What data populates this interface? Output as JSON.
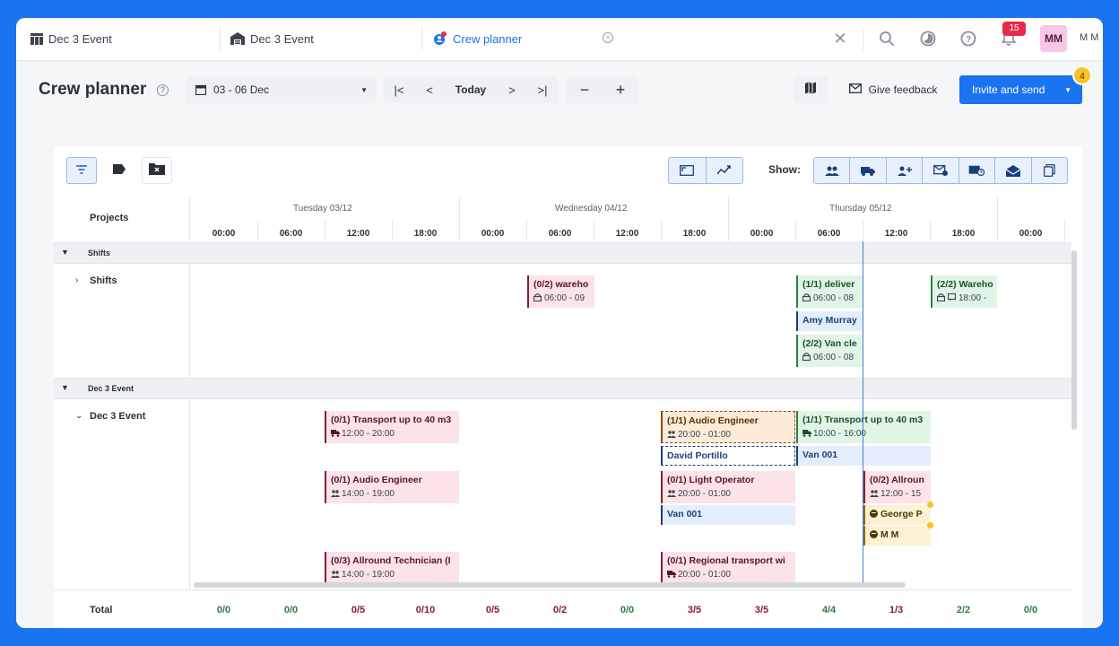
{
  "tabs": [
    {
      "label": "Dec 3 Event",
      "icon": "table-icon"
    },
    {
      "label": "Dec 3 Event",
      "icon": "warehouse-icon"
    },
    {
      "label": "Crew planner",
      "icon": "crew-planner-icon"
    }
  ],
  "topbar": {
    "notif_count": "15",
    "avatar_initials": "MM",
    "user_name": "M M"
  },
  "header": {
    "title": "Crew planner",
    "date_range": "03 - 06 Dec",
    "today_label": "Today",
    "zoom_out": "−",
    "zoom_in": "+",
    "feedback_label": "Give feedback",
    "invite_label": "Invite and send",
    "invite_badge": "4"
  },
  "toolbar": {
    "show_label": "Show:"
  },
  "grid": {
    "projects_header": "Projects",
    "days": [
      "Tuesday 03/12",
      "Wednesday 04/12",
      "Thursday 05/12"
    ],
    "hours": [
      "00:00",
      "06:00",
      "12:00",
      "18:00",
      "00:00",
      "06:00",
      "12:00",
      "18:00",
      "00:00",
      "06:00",
      "12:00",
      "18:00",
      "00:00"
    ],
    "groups": [
      {
        "label": "Shifts",
        "sub": "Shifts"
      },
      {
        "label": "Dec 3 Event",
        "sub": "Dec 3 Event"
      }
    ],
    "shift_cards": [
      {
        "title": "(0/2) wareho",
        "time": "06:00 - 09"
      },
      {
        "title": "(1/1) deliver",
        "time": "06:00 - 08"
      },
      {
        "title": "(2/2) Van cle",
        "time": "06:00 - 08"
      },
      {
        "title": "(2/2) Wareho",
        "time": "18:00 -"
      }
    ],
    "shift_chip": "Amy Murray",
    "event_cards": [
      {
        "title": "(0/1) Transport up to 40 m3",
        "time": "12:00 - 20:00"
      },
      {
        "title": "(0/1) Audio Engineer",
        "time": "14:00 - 19:00"
      },
      {
        "title": "(0/3) Allround Technician (I",
        "time": "14:00 - 19:00"
      },
      {
        "title": "(1/1) Audio Engineer",
        "time": "20:00 - 01:00"
      },
      {
        "title": "(0/1) Light Operator",
        "time": "20:00 - 01:00"
      },
      {
        "title": "(0/1) Regional transport wi",
        "time": "20:00 - 01:00"
      },
      {
        "title": "(1/1) Transport up to 40 m3",
        "time": "10:00 - 16:00"
      },
      {
        "title": "(0/2) Allroun",
        "time": "12:00 - 15"
      }
    ],
    "event_chips": [
      "David Portillo",
      "Van 001",
      "Van 001",
      "George P",
      "M M"
    ],
    "total_label": "Total",
    "totals": [
      "0/0",
      "0/0",
      "0/5",
      "0/10",
      "0/5",
      "0/2",
      "0/0",
      "3/5",
      "3/5",
      "4/4",
      "1/3",
      "2/2",
      "0/0"
    ]
  },
  "colors": {
    "accent": "#1a73f0",
    "pink": "#fbe3e8",
    "green": "#e0f5e6",
    "orange": "#fbebd8",
    "blue": "#e3edfb"
  }
}
